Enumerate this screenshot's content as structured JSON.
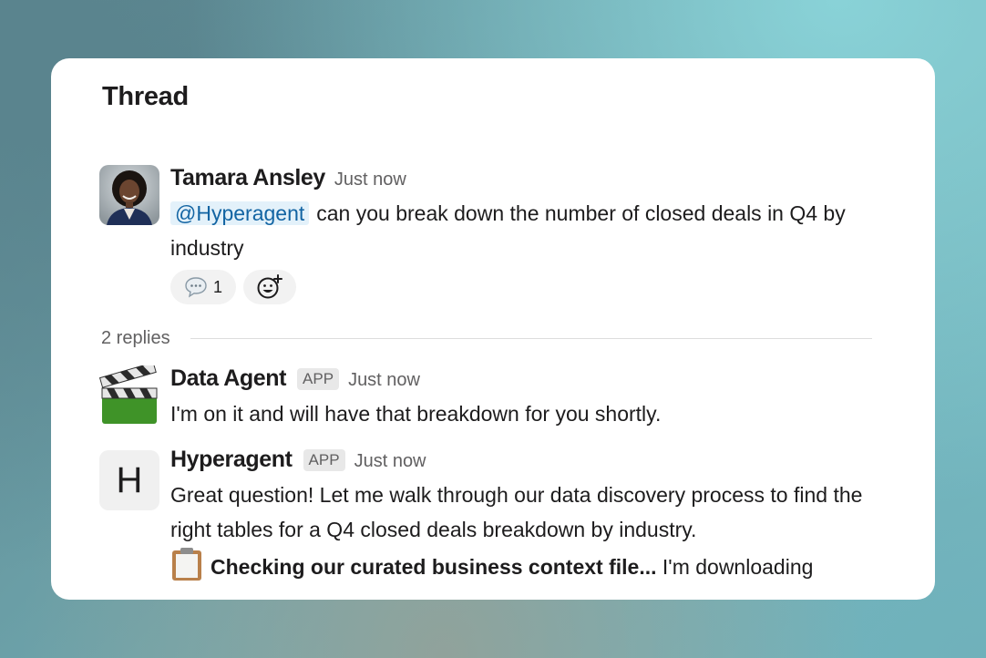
{
  "thread": {
    "title": "Thread"
  },
  "parent_message": {
    "author": "Tamara Ansley",
    "timestamp": "Just now",
    "mention": "@Hyperagent",
    "text_after_mention": "can you break down the number of closed deals in Q4 by industry",
    "reply_count": "1"
  },
  "replies": {
    "count_label": "2 replies",
    "items": [
      {
        "author": "Data Agent",
        "badge": "APP",
        "timestamp": "Just now",
        "text": "I'm on it and will have that breakdown for you shortly."
      },
      {
        "author": "Hyperagent",
        "avatar_letter": "H",
        "badge": "APP",
        "timestamp": "Just now",
        "text": "Great question! Let me walk through our data discovery process to find the right tables for a Q4 closed deals breakdown by industry.",
        "status_bold": "Checking our curated business context file...",
        "status_rest": "I'm downloading"
      }
    ]
  },
  "icons": {
    "reply_bubble": "speech-bubble-icon",
    "add_reaction": "add-reaction-icon",
    "data_agent_avatar": "clapperboard-icon",
    "status_clipboard": "clipboard-icon"
  },
  "colors": {
    "mention_text": "#1264a3",
    "mention_bg": "#e3f1fa",
    "text_primary": "#1d1c1d",
    "text_secondary": "#616061",
    "badge_bg": "#e8e8e8"
  }
}
